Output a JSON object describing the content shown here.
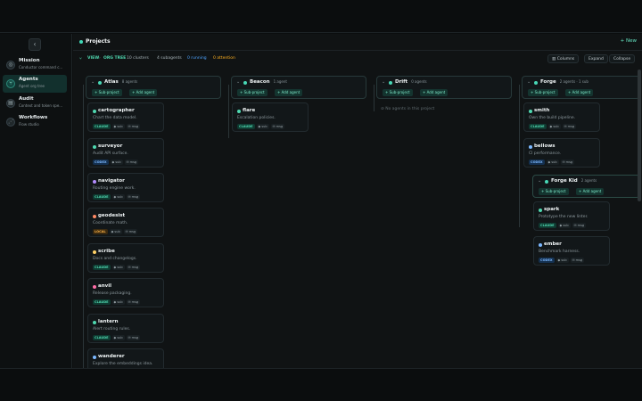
{
  "sidebar": {
    "items": [
      {
        "title": "Mission",
        "sub": "Conductor command c...",
        "icon": "mission-icon",
        "glyph": "◎"
      },
      {
        "title": "Agents",
        "sub": "Agent org tree",
        "icon": "agents-icon",
        "glyph": "⑂"
      },
      {
        "title": "Audit",
        "sub": "Context and token spe...",
        "icon": "audit-icon",
        "glyph": "▤"
      },
      {
        "title": "Workflows",
        "sub": "Flow studio",
        "icon": "workflows-icon",
        "glyph": "⋰"
      }
    ]
  },
  "header": {
    "title": "Projects",
    "new_label": "+ New"
  },
  "toolbar": {
    "view_prefix": "VIEW",
    "view_mode": "ORG TREE",
    "clusters": "10 clusters",
    "subagents": "4 subagents",
    "running": "0 running",
    "attention": "0 attention",
    "columns_label": "Columns",
    "expand_label": "Expand",
    "collapse_label": "Collapse"
  },
  "cluster_buttons": {
    "sub_project": "+ Sub-project",
    "add_agent": "+ Add agent"
  },
  "clusters": [
    {
      "name": "Atlas",
      "count": "8 agents"
    },
    {
      "name": "Beacon",
      "count": "1 agent"
    },
    {
      "name": "Drift",
      "count": "0 agents"
    },
    {
      "name": "Forge",
      "count": "2 agents · 1 sub"
    },
    {
      "name": "Forge Kid",
      "count": "2 agents"
    }
  ],
  "drift_empty": "No agents in this project",
  "agents": [
    {
      "name": "cartographer",
      "desc": "Chart the data model.",
      "engine": "CLAUDE",
      "color": "#4fd8b0"
    },
    {
      "name": "surveyor",
      "desc": "Audit API surface.",
      "engine": "CODEX",
      "color": "#4fd8b0"
    },
    {
      "name": "navigator",
      "desc": "Routing engine work.",
      "engine": "CLAUDE",
      "color": "#b48cff"
    },
    {
      "name": "geodesist",
      "desc": "Coordinate math.",
      "engine": "LOCAL",
      "color": "#ff8a65"
    },
    {
      "name": "scribe",
      "desc": "Docs and changelogs.",
      "engine": "CLAUDE",
      "color": "#ffd166"
    },
    {
      "name": "anvil",
      "desc": "Release packaging.",
      "engine": "CLAUDE",
      "color": "#ff6fa8"
    },
    {
      "name": "lantern",
      "desc": "Alert routing rules.",
      "engine": "CLAUDE",
      "color": "#4fd8b0"
    },
    {
      "name": "wanderer",
      "desc": "Explore the embeddings idea.",
      "engine": "",
      "color": "#7cb8ff"
    },
    {
      "name": "flare",
      "desc": "Escalation policies.",
      "engine": "CLAUDE",
      "color": "#4fd8b0"
    },
    {
      "name": "smith",
      "desc": "Own the build pipeline.",
      "engine": "CLAUDE",
      "color": "#4fd8b0"
    },
    {
      "name": "bellows",
      "desc": "CI performance.",
      "engine": "CODEX",
      "color": "#7cb8ff"
    },
    {
      "name": "spark",
      "desc": "Prototype the new linter.",
      "engine": "CLAUDE",
      "color": "#4fd8b0"
    },
    {
      "name": "ember",
      "desc": "Benchmark harness.",
      "engine": "CODEX",
      "color": "#7cb8ff"
    }
  ],
  "chips": {
    "sub": "◆ sub",
    "msg": "✉ msg"
  },
  "colors": {
    "accent": "#40d9b7",
    "running": "#4da3ff",
    "attention": "#ffb020"
  }
}
